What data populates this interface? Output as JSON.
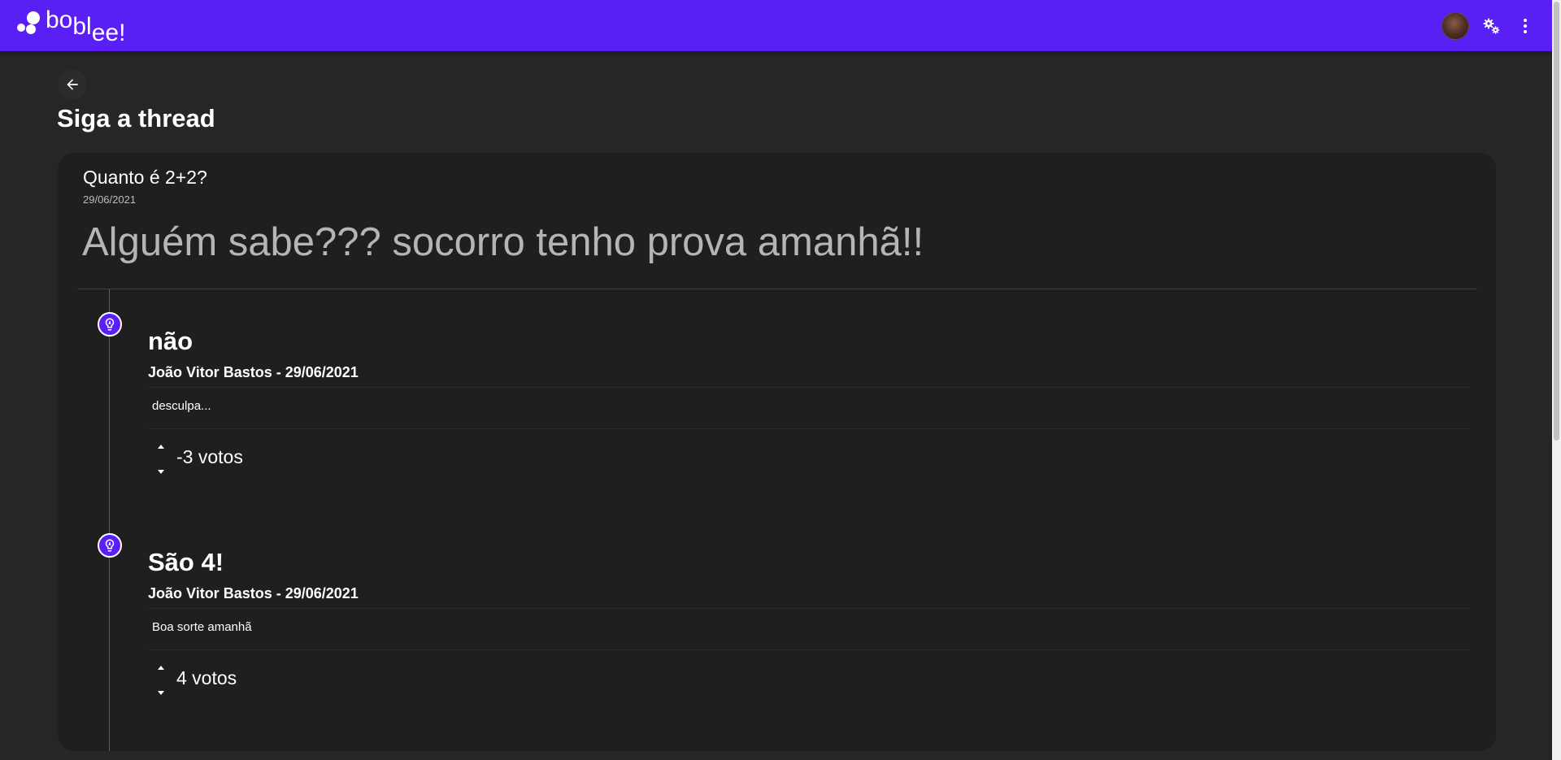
{
  "app": {
    "logo_parts": [
      "bo",
      "bl",
      "ee!"
    ],
    "brand_color": "#5a1ff5",
    "icons": [
      "avatar",
      "gears-icon",
      "more-vert-icon"
    ]
  },
  "page": {
    "title": "Siga a thread",
    "back_icon": "arrow-left-icon"
  },
  "thread": {
    "title": "Quanto é 2+2?",
    "date": "29/06/2021",
    "body": "Alguém sabe??? socorro tenho prova amanhã!!"
  },
  "answers": [
    {
      "icon": "lightbulb-icon",
      "title": "não",
      "meta": "João Vitor Bastos - 29/06/2021",
      "content": "desculpa...",
      "votes": "-3 votos"
    },
    {
      "icon": "lightbulb-icon",
      "title": "São 4!",
      "meta": "João Vitor Bastos - 29/06/2021",
      "content": "Boa sorte amanhã",
      "votes": "4 votos"
    }
  ]
}
